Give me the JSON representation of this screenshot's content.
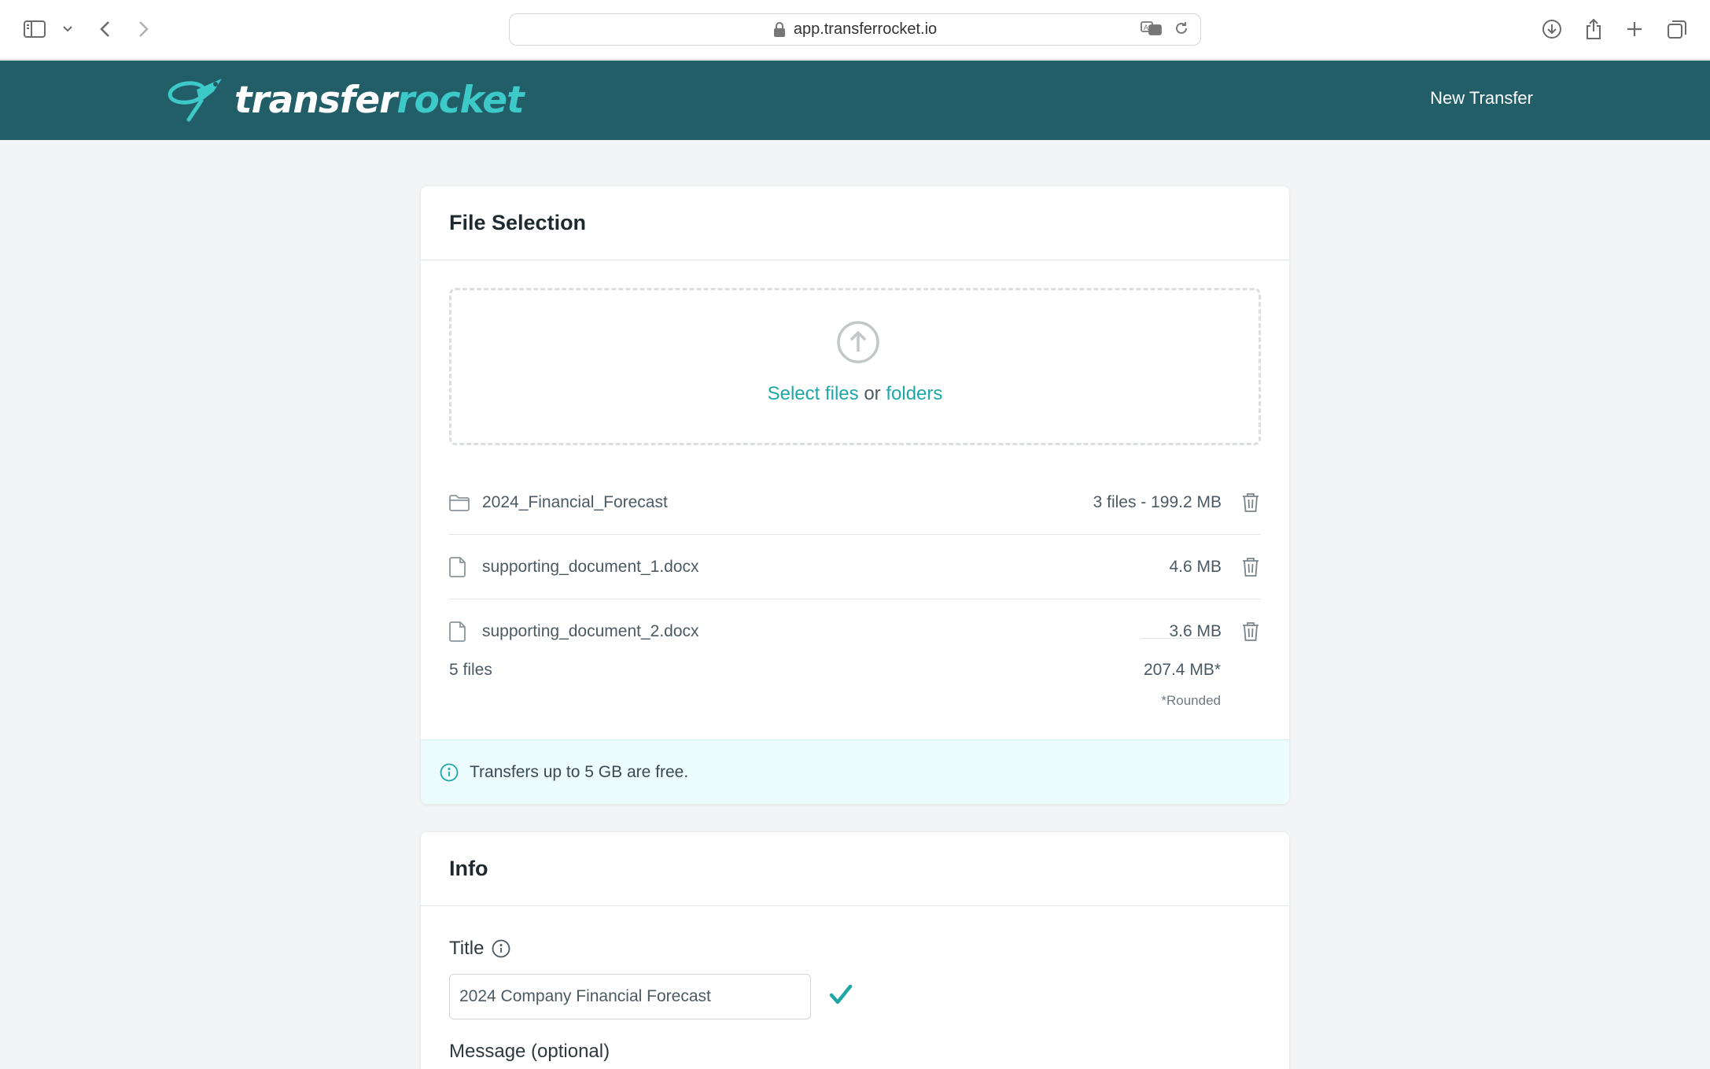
{
  "browser": {
    "url": "app.transferrocket.io"
  },
  "header": {
    "logo_part1": "transfer",
    "logo_part2": "rocket",
    "new_transfer_label": "New Transfer",
    "brand_color": "#225e68",
    "accent_color": "#3ec9c9"
  },
  "file_selection": {
    "title": "File Selection",
    "dropzone": {
      "select_files_label": "Select files",
      "or_text": "or",
      "folders_label": "folders",
      "icon": "upload-arrow-icon"
    },
    "items": [
      {
        "name": "2024_Financial_Forecast",
        "size": "3 files - 199.2 MB",
        "icon": "folder-icon"
      },
      {
        "name": "supporting_document_1.docx",
        "size": "4.6 MB",
        "icon": "file-icon"
      },
      {
        "name": "supporting_document_2.docx",
        "size": "3.6 MB",
        "icon": "file-icon"
      }
    ],
    "total_count": "5 files",
    "total_size": "207.4 MB*",
    "rounded_note": "*Rounded",
    "info_message": "Transfers up to 5 GB are free."
  },
  "info": {
    "title": "Info",
    "title_label": "Title",
    "title_value": "2024 Company Financial Forecast",
    "message_label": "Message (optional)"
  }
}
